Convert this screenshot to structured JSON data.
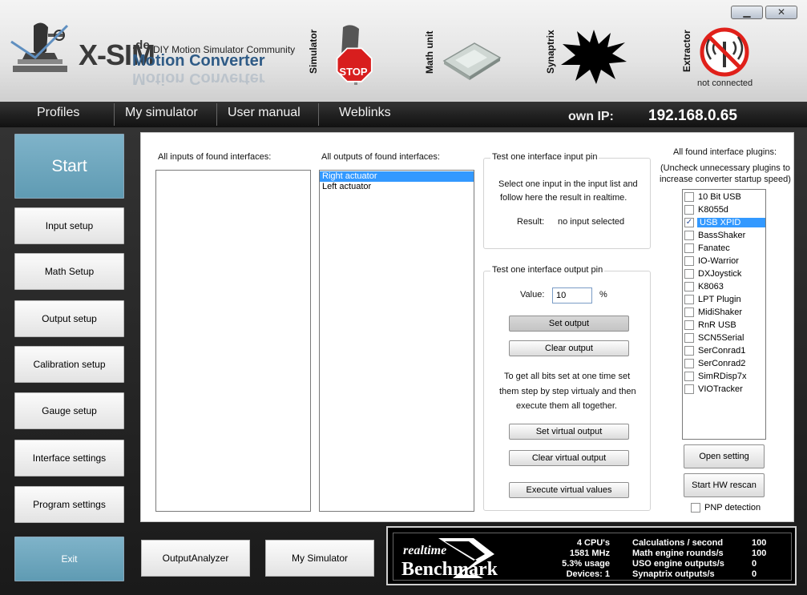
{
  "window": {
    "minimize_glyph": "▁",
    "close_glyph": "✕"
  },
  "logo": {
    "brand": "X-SIM",
    "domain": ".de",
    "tagline": "DIY Motion Simulator Community",
    "product": "Motion Converter"
  },
  "status": {
    "simulator_label": "Simulator",
    "simulator_icon": "stop-sign-icon",
    "stop_text": "STOP",
    "math_label": "Math unit",
    "math_icon": "chip-icon",
    "synaptrix_label": "Synaptrix",
    "synaptrix_icon": "starburst-icon",
    "extractor_label": "Extractor",
    "extractor_icon": "no-signal-icon",
    "extractor_status": "not connected"
  },
  "nav": {
    "items": [
      "Profiles",
      "My simulator",
      "User manual",
      "Weblinks"
    ],
    "own_ip_label": "own IP:",
    "own_ip": "192.168.0.65"
  },
  "sidebar": {
    "start": "Start",
    "items": [
      "Input setup",
      "Math Setup",
      "Output setup",
      "Calibration setup",
      "Gauge setup",
      "Interface settings",
      "Program settings"
    ],
    "exit": "Exit"
  },
  "inputs": {
    "label": "All inputs of found interfaces:",
    "items": []
  },
  "outputs": {
    "label": "All outputs of found interfaces:",
    "items": [
      "Right actuator",
      "Left actuator"
    ],
    "selected": "Right actuator"
  },
  "input_test": {
    "title": "Test one interface input pin",
    "desc_line1": "Select one input in the input list and",
    "desc_line2": "follow here the result in realtime.",
    "result_label": "Result:",
    "result_value": "no input selected"
  },
  "output_test": {
    "title": "Test one interface output pin",
    "value_label": "Value:",
    "value": "10",
    "unit": "%",
    "set_output": "Set output",
    "clear_output": "Clear output",
    "desc_line1": "To get all bits set at one time set",
    "desc_line2": "them step by step virtualy and then",
    "desc_line3": "execute them all together.",
    "set_virtual": "Set virtual output",
    "clear_virtual": "Clear virtual output",
    "execute_virtual": "Execute virtual values"
  },
  "plugins": {
    "label": "All found interface plugins:",
    "hint_line1": "(Uncheck unnecessary plugins to",
    "hint_line2": "increase converter startup speed)",
    "items": [
      {
        "name": "10 Bit USB",
        "checked": false
      },
      {
        "name": "K8055d",
        "checked": false
      },
      {
        "name": "USB XPID",
        "checked": true
      },
      {
        "name": "BassShaker",
        "checked": false
      },
      {
        "name": "Fanatec",
        "checked": false
      },
      {
        "name": "IO-Warrior",
        "checked": false
      },
      {
        "name": "DXJoystick",
        "checked": false
      },
      {
        "name": "K8063",
        "checked": false
      },
      {
        "name": "LPT Plugin",
        "checked": false
      },
      {
        "name": "MidiShaker",
        "checked": false
      },
      {
        "name": "RnR USB",
        "checked": false
      },
      {
        "name": "SCN5Serial",
        "checked": false
      },
      {
        "name": "SerConrad1",
        "checked": false
      },
      {
        "name": "SerConrad2",
        "checked": false
      },
      {
        "name": "SimRDisp7x",
        "checked": false
      },
      {
        "name": "VIOTracker",
        "checked": false
      }
    ],
    "selected": "USB XPID",
    "open_setting": "Open setting",
    "hw_rescan": "Start HW rescan",
    "pnp_label": "PNP detection",
    "pnp_checked": false
  },
  "bottom": {
    "output_analyzer": "OutputAnalyzer",
    "my_simulator": "My Simulator"
  },
  "benchmark": {
    "logo_line1": "realtime",
    "logo_line2": "Benchmark",
    "cpus": "4 CPU's",
    "mhz": "1581 MHz",
    "usage": "5.3% usage",
    "devices": "Devices: 1",
    "labels": [
      "Calculations / second",
      "Math engine rounds/s",
      "USO engine outputs/s",
      "Synaptrix outputs/s"
    ],
    "values": [
      "100",
      "100",
      "0",
      "0"
    ]
  }
}
